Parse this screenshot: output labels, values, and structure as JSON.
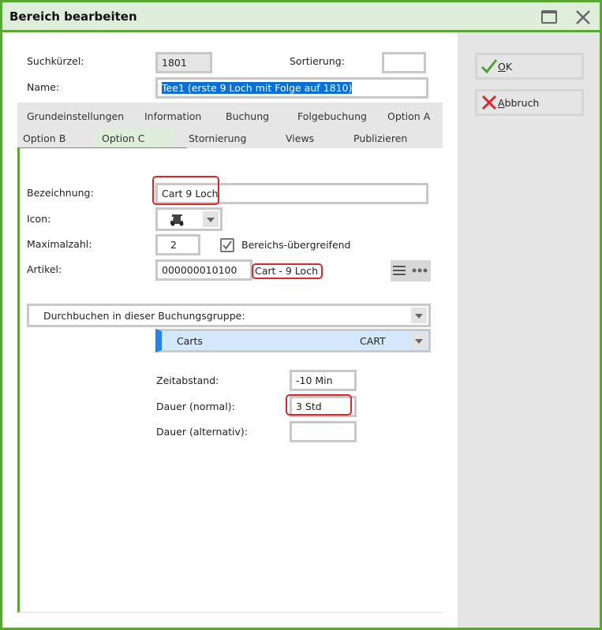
{
  "window": {
    "title": "Bereich bearbeiten"
  },
  "header": {
    "suchkuerzel_label": "Suchkürzel:",
    "suchkuerzel_value": "1801",
    "sortierung_label": "Sortierung:",
    "sortierung_value": "",
    "name_label": "Name:",
    "name_value": "Tee1 (erste 9 Loch mit Folge auf 1810)"
  },
  "tabs": {
    "row1": [
      "Grundeinstellungen",
      "Information",
      "Buchung",
      "Folgebuchung",
      "Option A"
    ],
    "row2": [
      "Option B",
      "Option C",
      "Stornierung",
      "Views",
      "Publizieren"
    ],
    "active": "Option C"
  },
  "form": {
    "bezeichnung_label": "Bezeichnung:",
    "bezeichnung_value": "Cart 9 Loch",
    "icon_label": "Icon:",
    "maximalzahl_label": "Maximalzahl:",
    "maximalzahl_value": "2",
    "bereichs_label": "Bereichs-übergreifend",
    "bereichs_checked": true,
    "artikel_label": "Artikel:",
    "artikel_value": "000000010100",
    "artikel_name": "Cart - 9 Loch",
    "durchbuchen_label": "Durchbuchen in dieser Buchungsgruppe:",
    "gruppe_name": "Carts",
    "gruppe_code": "CART",
    "zeitabstand_label": "Zeitabstand:",
    "zeitabstand_value": "-10 Min",
    "dauer_normal_label": "Dauer (normal):",
    "dauer_normal_value": "3 Std",
    "dauer_alt_label": "Dauer (alternativ):",
    "dauer_alt_value": ""
  },
  "buttons": {
    "ok_mnemonic": "O",
    "ok_rest": "K",
    "cancel_mnemonic": "A",
    "cancel_rest": "bbruch"
  },
  "colors": {
    "accent": "#5aa632",
    "highlight": "#e0262b",
    "selection": "#0a6fd6"
  }
}
